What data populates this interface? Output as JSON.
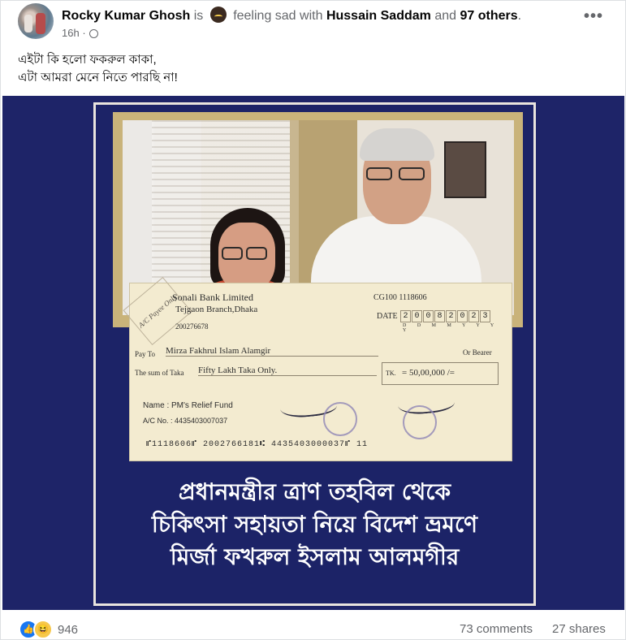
{
  "post": {
    "author": "Rocky Kumar Ghosh",
    "is_text": "is",
    "feeling_text": "feeling sad with",
    "tagged_person": "Hussain Saddam",
    "and_text": "and",
    "others": "97 others",
    "period": ".",
    "time": "16h",
    "text_line1": "এইটা কি হলো ফকরুল কাকা,",
    "text_line2": "এটা আমরা মেনে নিতে পারছি না!"
  },
  "cheque": {
    "stamp": "A/C Payee Only",
    "bank": "Sonali Bank Limited",
    "branch": "Tejgaon Branch,Dhaka",
    "account_code": "200276678",
    "cheque_no": "CG100  1118606",
    "date_label": "DATE",
    "date_digits": [
      "2",
      "0",
      "0",
      "8",
      "2",
      "0",
      "2",
      "3"
    ],
    "date_format": "D D M M Y Y Y Y",
    "pay_to_label": "Pay To",
    "payee": "Mirza Fakhrul Islam Alamgir",
    "or_bearer": "Or Bearer",
    "sum_label": "The sum of Taka",
    "amount_words": "Fifty Lakh Taka Only.",
    "tk_label": "TK.",
    "amount": "= 50,00,000 /=",
    "name_line": "Name : PM's Relief Fund",
    "ac_line": "A/C No. : 4435403007037",
    "micr": "⑈1118606⑈  2002766181⑆ 4435403000037⑈  11"
  },
  "headline": {
    "line1": "প্রধানমন্ত্রীর ত্রাণ তহবিল থেকে",
    "line2": "চিকিৎসা সহায়তা নিয়ে বিদেশ ভ্রমণে",
    "line3": "মির্জা ফখরুল ইসলাম আলমগীর"
  },
  "footer": {
    "reaction_count": "946",
    "comments": "73 comments",
    "shares": "27 shares"
  },
  "icons": {
    "more": "more-options-icon",
    "privacy": "globe-icon",
    "like": "like-reaction-icon",
    "haha": "haha-reaction-icon",
    "feeling": "sad-emoji-icon"
  },
  "colors": {
    "image_background": "#1e2468",
    "like_blue": "#1877f2",
    "meta_gray": "#65676b"
  }
}
